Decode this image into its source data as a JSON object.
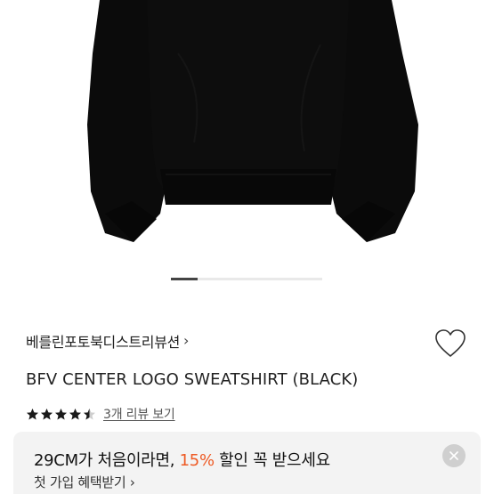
{
  "product": {
    "brand": "베를린포토북디스트리뷰션",
    "brand_chevron": "›",
    "title": "BFV CENTER LOGO SWEATSHIRT (BLACK)",
    "rating": 4.5,
    "review_link": "3개 리뷰 보기"
  },
  "gallery": {
    "image_position": 1,
    "indicator_segments": 5
  },
  "promo": {
    "main_before": "29CM가 처음이라면, ",
    "main_percent": "15%",
    "main_after": " 할인 꼭 받으세요",
    "sub": "첫 가입 혜택받기",
    "sub_chevron": "›"
  },
  "icons": {
    "wishlist": "heart-outline-icon",
    "close": "close-icon",
    "star": "star-icon"
  },
  "colors": {
    "accent": "#ee5a24",
    "garment": "#0b0b0b",
    "indicator_active": "#444444"
  }
}
